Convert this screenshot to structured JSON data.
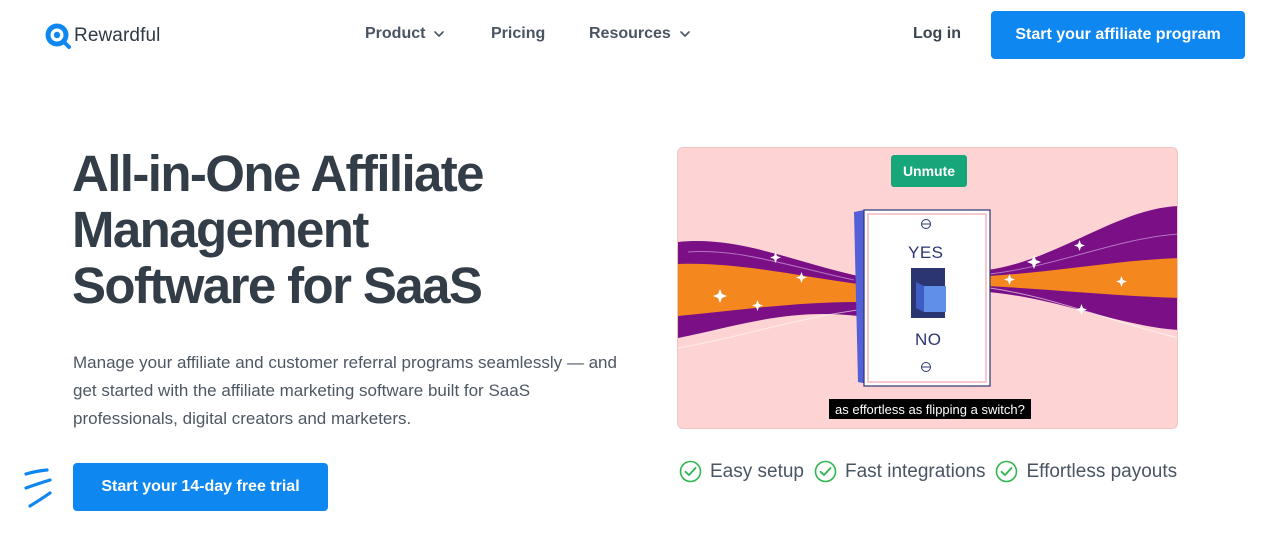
{
  "colors": {
    "primary": "#0f87f0",
    "heading": "#323d48",
    "body": "#4d5865",
    "unmute": "#17a57a",
    "check": "#2fb54d",
    "video_bg": "#fdd3d3",
    "ribbon_orange": "#f5871f",
    "ribbon_purple": "#7a0f86"
  },
  "nav": {
    "brand": "Rewardful",
    "brand_icon": "rewardful-logo-icon",
    "items": [
      {
        "label": "Product",
        "has_dropdown": true,
        "icon": "chevron-down-icon"
      },
      {
        "label": "Pricing",
        "has_dropdown": false
      },
      {
        "label": "Resources",
        "has_dropdown": true,
        "icon": "chevron-down-icon"
      }
    ],
    "login": "Log in",
    "cta": "Start your affiliate program"
  },
  "hero": {
    "title_lines": [
      "All-in-One Affiliate",
      "Management",
      "Software for SaaS"
    ],
    "subtitle": "Manage your affiliate and customer referral programs seamlessly — and get started with the affiliate marketing software built for SaaS professionals, digital creators and marketers.",
    "cta": "Start your 14-day free trial"
  },
  "video": {
    "unmute_label": "Unmute",
    "caption": "as effortless as flipping a switch?",
    "switch_top_label": "YES",
    "switch_bottom_label": "NO"
  },
  "features": [
    {
      "label": "Easy setup",
      "icon": "check-circle-icon"
    },
    {
      "label": "Fast integrations",
      "icon": "check-circle-icon"
    },
    {
      "label": "Effortless payouts",
      "icon": "check-circle-icon"
    }
  ]
}
